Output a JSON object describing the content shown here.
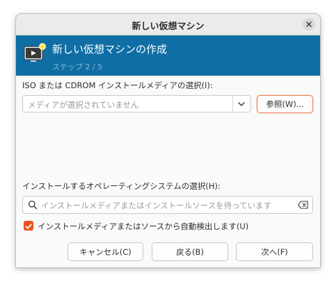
{
  "window": {
    "title": "新しい仮想マシン"
  },
  "banner": {
    "title": "新しい仮想マシンの作成",
    "step": "ステップ 2 / 5",
    "icon": "monitor-star-icon",
    "color": "#0f6ea4"
  },
  "iso": {
    "label": "ISO または CDROM インストールメディアの選択(I):",
    "placeholder": "メディアが選択されていません",
    "browse_label": "参照(W)..."
  },
  "os": {
    "label": "インストールするオペレーティングシステムの選択(H):",
    "search_placeholder": "インストールメディアまたはインストールソースを待っています",
    "autodetect_label": "インストールメディアまたはソースから自動検出します(U)",
    "autodetect_checked": true
  },
  "buttons": {
    "cancel": "キャンセル(C)",
    "back": "戻る(B)",
    "next": "次へ(F)"
  },
  "colors": {
    "accent": "#e95420",
    "banner": "#0f6ea4"
  }
}
